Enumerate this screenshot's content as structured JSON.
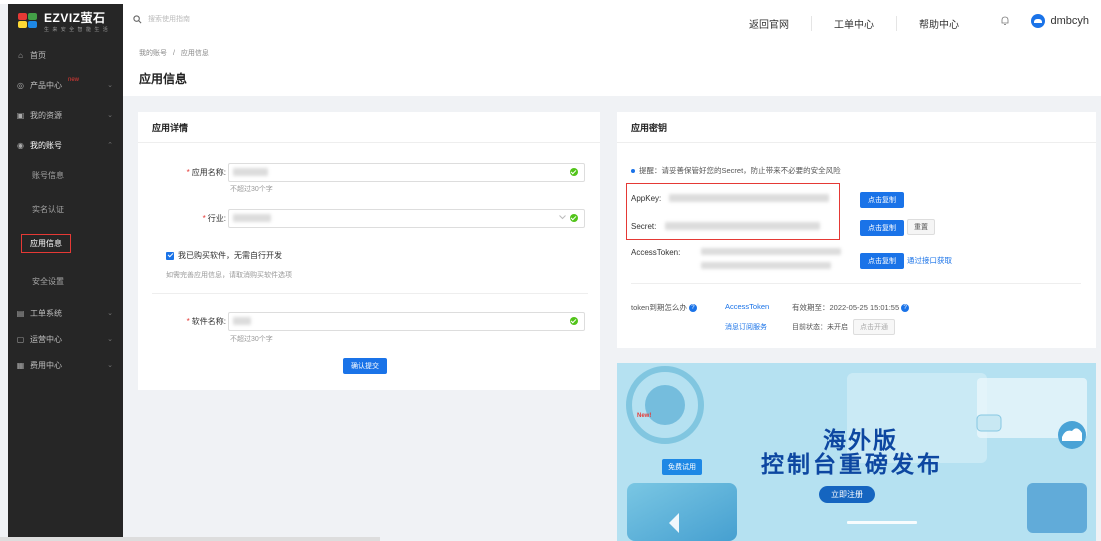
{
  "brand": {
    "name": "EZVIZ萤石",
    "subtitle": "生 来 安 全 智 能 生 活",
    "colors": [
      "#e53935",
      "#43a047",
      "#1e88e5",
      "#fdd835"
    ]
  },
  "header": {
    "search_placeholder": "搜索使用指南",
    "nav": [
      "返回官网",
      "工单中心",
      "帮助中心"
    ],
    "username": "dmbcyh"
  },
  "sidebar": {
    "items": [
      {
        "label": "首页",
        "icon": "home-icon",
        "glyph": "⌂"
      },
      {
        "label": "产品中心",
        "icon": "product-icon",
        "glyph": "◎",
        "badge": "new",
        "caret": "⌄"
      },
      {
        "label": "我的资源",
        "icon": "resource-icon",
        "glyph": "▣",
        "caret": "⌄"
      },
      {
        "label": "我的账号",
        "icon": "account-icon",
        "glyph": "◉",
        "caret": "⌃",
        "expanded": true
      },
      {
        "label": "工单系统",
        "icon": "ticket-icon",
        "glyph": "▤",
        "caret": "⌄"
      },
      {
        "label": "运营中心",
        "icon": "operation-icon",
        "glyph": "▢",
        "caret": "⌄"
      },
      {
        "label": "费用中心",
        "icon": "billing-icon",
        "glyph": "▦",
        "caret": "⌄"
      }
    ],
    "sub_items": [
      "账号信息",
      "实名认证",
      "应用信息",
      "安全设置"
    ]
  },
  "breadcrumb": {
    "parent": "我的账号",
    "separator": "/",
    "current": "应用信息"
  },
  "page_title": "应用信息",
  "app_detail": {
    "title": "应用详情",
    "app_name_label": "应用名称:",
    "app_name_hint": "不超过30个字",
    "industry_label": "行业:",
    "checkbox_label": "我已购买软件，无需自行开发",
    "checkbox_hint": "如需完善应用信息，请取消购买软件选项",
    "software_label": "软件名称:",
    "software_hint": "不超过30个字",
    "submit_label": "确认提交"
  },
  "app_keys": {
    "title": "应用密钥",
    "notice": "提醒：请妥善保管好您的Secret，防止带来不必要的安全风险",
    "appkey_label": "AppKey:",
    "secret_label": "Secret:",
    "token_label": "AccessToken:",
    "copy_label": "点击复制",
    "reset_label": "重置",
    "api_link": "通过接口获取",
    "expire_q": "token到期怎么办",
    "token_link": "AccessToken",
    "expire_text": "有效期至：2022-05-25 15:01:55",
    "msg_link": "消息订阅服务",
    "status_text": "目前状态：未开启",
    "open_label": "点击开通"
  },
  "banner": {
    "line1": "海外版",
    "line2": "控制台重磅发布",
    "cta": "立即注册",
    "tag": "免费试用",
    "new_tag": "New!"
  }
}
